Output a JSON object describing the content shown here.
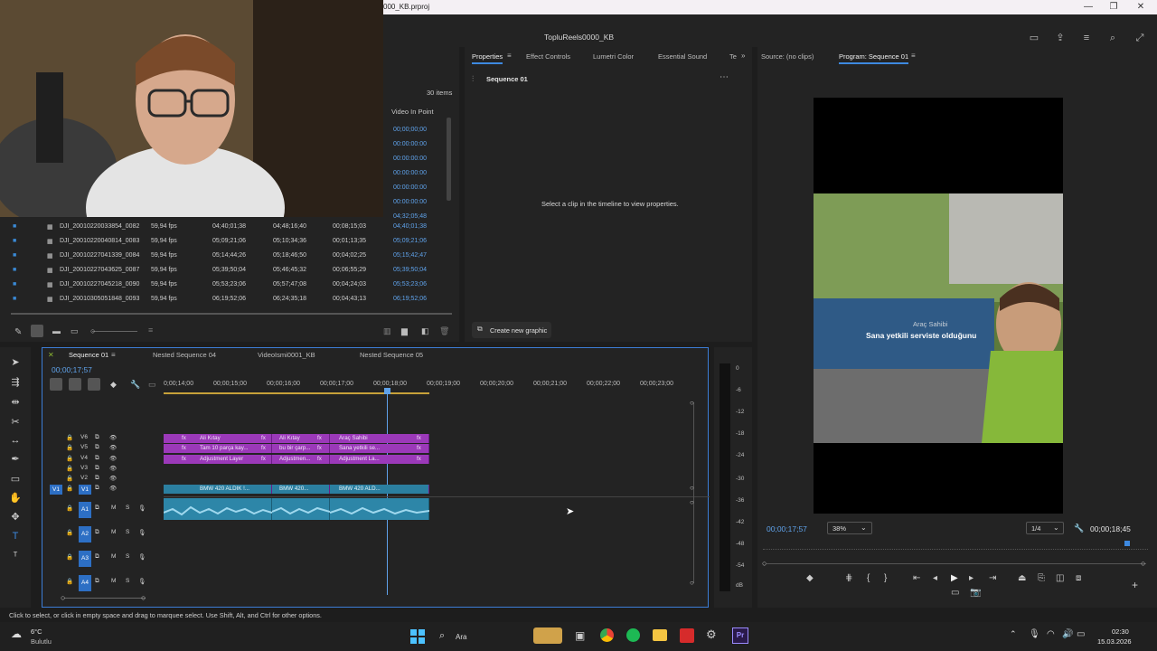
{
  "window": {
    "title": "000_KB.prproj",
    "project_title": "TopluReels0000_KB",
    "controls": [
      "—",
      "❐",
      "✕"
    ]
  },
  "project_panel": {
    "items_count": "30 items",
    "column_video_in_point": "Video In Point",
    "in_points_partial": [
      "00;00;00;00",
      "00:00:00:00",
      "00:00:00:00",
      "00:00:00:00",
      "00:00:00:00",
      "00:00:00:00",
      "04;32;05;48"
    ],
    "rows": [
      {
        "name": "DJI_20010220033854_0082",
        "fps": "59,94 fps",
        "start": "04;40;01;38",
        "end": "04;48;16;40",
        "duration": "00;08;15;03",
        "in_point": "04;40;01;38"
      },
      {
        "name": "DJI_20010220040814_0083",
        "fps": "59,94 fps",
        "start": "05;09;21;06",
        "end": "05;10;34;36",
        "duration": "00;01;13;35",
        "in_point": "05;09;21;06"
      },
      {
        "name": "DJI_20010227041339_0084",
        "fps": "59,94 fps",
        "start": "05;14;44;26",
        "end": "05;18;46;50",
        "duration": "00;04;02;25",
        "in_point": "05;15;42;47"
      },
      {
        "name": "DJI_20010227043625_0087",
        "fps": "59,94 fps",
        "start": "05;39;50;04",
        "end": "05;46;45;32",
        "duration": "00;06;55;29",
        "in_point": "05;39;50;04"
      },
      {
        "name": "DJI_20010227045218_0090",
        "fps": "59,94 fps",
        "start": "05;53;23;06",
        "end": "05;57;47;08",
        "duration": "00;04;24;03",
        "in_point": "05;53;23;06"
      },
      {
        "name": "DJI_20010305051848_0093",
        "fps": "59,94 fps",
        "start": "06;19;52;06",
        "end": "06;24;35;18",
        "duration": "00;04;43;13",
        "in_point": "06;19;52;06"
      }
    ]
  },
  "properties_panel": {
    "tabs": [
      "Properties",
      "Effect Controls",
      "Lumetri Color",
      "Essential Sound",
      "Te"
    ],
    "sequence_name": "Sequence 01",
    "empty_message": "Select a clip in the timeline to view properties.",
    "create_button": "Create new graphic"
  },
  "program_monitor": {
    "source_tab": "Source: (no clips)",
    "program_tab": "Program: Sequence 01",
    "timecode": "00;00;17;57",
    "zoom": "38%",
    "resolution": "1/4",
    "duration": "00;00;18;45",
    "subtitle_top": "Araç Sahibi",
    "subtitle_main": "Sana yetkili serviste olduğunu"
  },
  "timeline": {
    "tabs": [
      "Sequence 01",
      "Nested Sequence 04",
      "VideoIsmi0001_KB",
      "Nested Sequence 05"
    ],
    "timecode": "00;00;17;57",
    "ruler": [
      "0;00;14;00",
      "00;00;15;00",
      "00;00;16;00",
      "00;00;17;00",
      "00;00;18;00",
      "00;00;19;00",
      "00;00;20;00",
      "00;00;21;00",
      "00;00;22;00",
      "00;00;23;00"
    ],
    "video_tracks": [
      "V6",
      "V5",
      "V4",
      "V3",
      "V2",
      "V1"
    ],
    "audio_tracks": [
      "A1",
      "A2",
      "A3",
      "A4"
    ],
    "source_patch": "V1",
    "v6_clips": [
      "Ali Kıtay",
      "Ali Kıtay",
      "Araç Sahibi"
    ],
    "v5_clips": [
      "Tam 10 parça kay...",
      "bu bir çarp...",
      "Sana yetkili se..."
    ],
    "v4_clips": [
      "Adjustment Layer",
      "Adjustmen...",
      "Adjustment La..."
    ],
    "v1_clips": [
      "BMW 420 ALDIK !...",
      "BMW 420...",
      "BMW 420 ALD..."
    ],
    "fx": "fx",
    "M": "M",
    "S": "S"
  },
  "meters": [
    "0",
    "-6",
    "-12",
    "-18",
    "-24",
    "-30",
    "-36",
    "-42",
    "-48",
    "-54",
    "dB"
  ],
  "status_bar": "Click to select, or click in empty space and drag to marquee select. Use Shift, Alt, and Ctrl for other options.",
  "taskbar": {
    "weather_temp": "6°C",
    "weather_desc": "Bulutlu",
    "search": "Ara",
    "time": "02:30",
    "date": "15.03.2026"
  }
}
